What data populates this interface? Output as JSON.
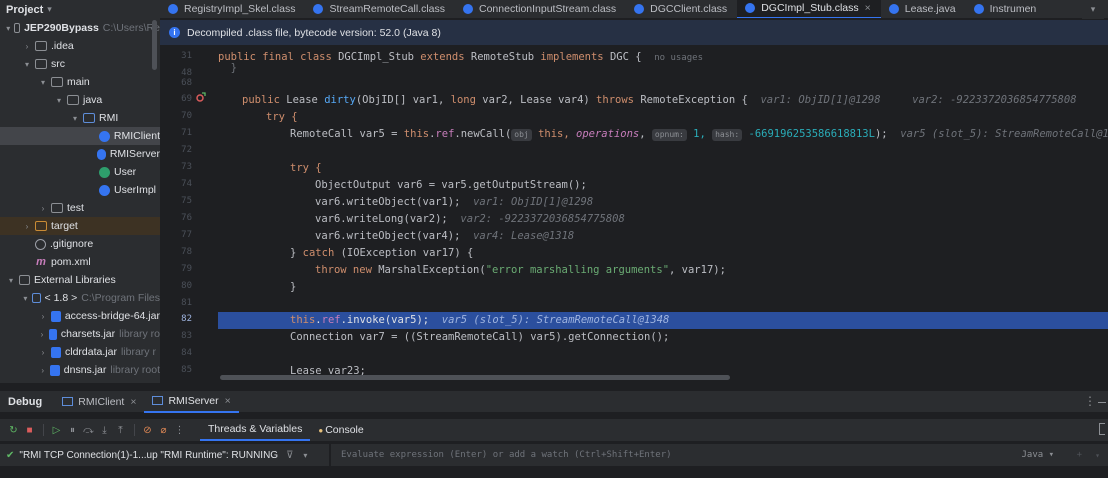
{
  "project": {
    "header_label": "Project",
    "chevron": "▾",
    "tree": [
      {
        "label": "JEP290Bypass",
        "hint": "C:\\Users\\Re",
        "icon": "folder-icon",
        "arrow": "▾",
        "indent": 6,
        "bold": true
      },
      {
        "label": ".idea",
        "hint": "",
        "icon": "folder-icon",
        "arrow": "›",
        "indent": 22
      },
      {
        "label": "src",
        "hint": "",
        "icon": "folder-icon",
        "arrow": "▾",
        "indent": 22
      },
      {
        "label": "main",
        "hint": "",
        "icon": "folder-icon",
        "arrow": "▾",
        "indent": 38
      },
      {
        "label": "java",
        "hint": "",
        "icon": "folder-icon",
        "arrow": "▾",
        "indent": 54
      },
      {
        "label": "RMI",
        "hint": "",
        "icon": "package-icon",
        "arrow": "▾",
        "indent": 70
      },
      {
        "label": "RMIClient",
        "hint": "",
        "icon": "class-icon",
        "arrow": "",
        "indent": 86,
        "selected": true
      },
      {
        "label": "RMIServer",
        "hint": "",
        "icon": "class-icon",
        "arrow": "",
        "indent": 86
      },
      {
        "label": "User",
        "hint": "",
        "icon": "interface-icon",
        "arrow": "",
        "indent": 86
      },
      {
        "label": "UserImpl",
        "hint": "",
        "icon": "class-icon",
        "arrow": "",
        "indent": 86
      },
      {
        "label": "test",
        "hint": "",
        "icon": "folder-icon",
        "arrow": "›",
        "indent": 38
      },
      {
        "label": "target",
        "hint": "",
        "icon": "folder-orange-icon",
        "arrow": "›",
        "indent": 22,
        "excluded": true
      },
      {
        "label": ".gitignore",
        "hint": "",
        "icon": "gitignore-icon",
        "arrow": "",
        "indent": 22
      },
      {
        "label": "pom.xml",
        "hint": "",
        "icon": "maven-icon",
        "arrow": "",
        "indent": 22
      },
      {
        "label": "External Libraries",
        "hint": "",
        "icon": "library-icon",
        "arrow": "▾",
        "indent": 6
      },
      {
        "label": "< 1.8 >",
        "hint": "C:\\Program Files",
        "icon": "jdk-icon",
        "arrow": "▾",
        "indent": 22
      },
      {
        "label": "access-bridge-64.jar",
        "hint": "",
        "icon": "jar-icon",
        "arrow": "›",
        "indent": 38
      },
      {
        "label": "charsets.jar",
        "hint": "library ro",
        "icon": "jar-icon",
        "arrow": "›",
        "indent": 38
      },
      {
        "label": "cldrdata.jar",
        "hint": "library r",
        "icon": "jar-icon",
        "arrow": "›",
        "indent": 38
      },
      {
        "label": "dnsns.jar",
        "hint": "library root",
        "icon": "jar-icon",
        "arrow": "›",
        "indent": 38
      }
    ]
  },
  "tabs": [
    {
      "label": "RegistryImpl_Skel.class",
      "active": false
    },
    {
      "label": "StreamRemoteCall.class",
      "active": false
    },
    {
      "label": "ConnectionInputStream.class",
      "active": false
    },
    {
      "label": "DGCClient.class",
      "active": false
    },
    {
      "label": "DGCImpl_Stub.class",
      "active": true
    },
    {
      "label": "Lease.java",
      "active": false
    },
    {
      "label": "Instrumen",
      "active": false
    }
  ],
  "banner_text": "Decompiled .class file, bytecode version: 52.0 (Java 8)",
  "usage_hint": "no usages",
  "line_numbers": [
    "31",
    "48",
    "68",
    "69",
    "70",
    "71",
    "72",
    "73",
    "74",
    "75",
    "76",
    "77",
    "78",
    "79",
    "80",
    "81",
    "82",
    "83",
    "84",
    "85"
  ],
  "code": {
    "l31": {
      "a": "public final class ",
      "b": "DGCImpl_Stub",
      "c": " extends ",
      "d": "RemoteStub",
      "e": " implements ",
      "f": "DGC {"
    },
    "l69": {
      "a": "public ",
      "b": "Lease ",
      "c": "dirty",
      "d": "(ObjID[] var1, ",
      "e": "long ",
      "f": "var2, Lease var4) ",
      "g": "throws ",
      "h": "RemoteException {",
      "i": "var1: ObjID[1]@1298     var2: -9223372036854775808     var4: Lease"
    },
    "l70": {
      "a": "try {"
    },
    "l71": {
      "a": "RemoteCall var5 = ",
      "b": "this",
      "c": ".",
      "d": "ref",
      "e": ".newCall(",
      "f": "obj",
      "g": " this, ",
      "h": "operations",
      "i": ", ",
      "j": "opnum:",
      "k": " 1, ",
      "l": "hash:",
      "m": " -669196253586618813L",
      "n": ");",
      "o": "var5 (slot_5): StreamRemoteCall@13"
    },
    "l73": {
      "a": "try {"
    },
    "l74": {
      "a": "ObjectOutput var6 = var5.getOutputStream();"
    },
    "l75": {
      "a": "var6.writeObject(var1);",
      "b": "var1: ObjID[1]@1298"
    },
    "l76": {
      "a": "var6.writeLong(var2);",
      "b": "var2: -9223372036854775808"
    },
    "l77": {
      "a": "var6.writeObject(var4);",
      "b": "var4: Lease@1318"
    },
    "l78": {
      "a": "} ",
      "b": "catch ",
      "c": "(IOException var17) {"
    },
    "l79": {
      "a": "throw new ",
      "b": "MarshalException(",
      "c": "\"error marshalling arguments\"",
      "d": ", var17);"
    },
    "l80": {
      "a": "}"
    },
    "l82": {
      "a": "this",
      "b": ".",
      "c": "ref",
      "d": ".invoke(var5);",
      "e": "var5 (slot_5): StreamRemoteCall@1348"
    },
    "l83": {
      "a": "Connection var7 = ((StreamRemoteCall) var5).getConnection();"
    },
    "l85": {
      "a": "Lease var23;"
    }
  },
  "debug": {
    "title": "Debug",
    "tabs": [
      {
        "label": "RMIClient",
        "active": false
      },
      {
        "label": "RMIServer",
        "active": true
      }
    ],
    "menu": "⋮",
    "view_tabs": [
      {
        "label": "Threads & Variables",
        "active": true
      },
      {
        "label": "Console",
        "active": false
      }
    ],
    "thread_label": "\"RMI TCP Connection(1)-1...up \"RMI Runtime\": RUNNING",
    "eval_placeholder": "Evaluate expression (Enter) or add a watch (Ctrl+Shift+Enter)",
    "eval_lang": "Java ▾"
  },
  "colors": {
    "accent": "#3574f0",
    "keyword": "#cf8e6d",
    "string": "#6aab73",
    "number": "#2aacb8",
    "field": "#c77dbb",
    "method": "#56a8f5",
    "highlight_row": "#2b4f9e",
    "banner": "#263044"
  }
}
